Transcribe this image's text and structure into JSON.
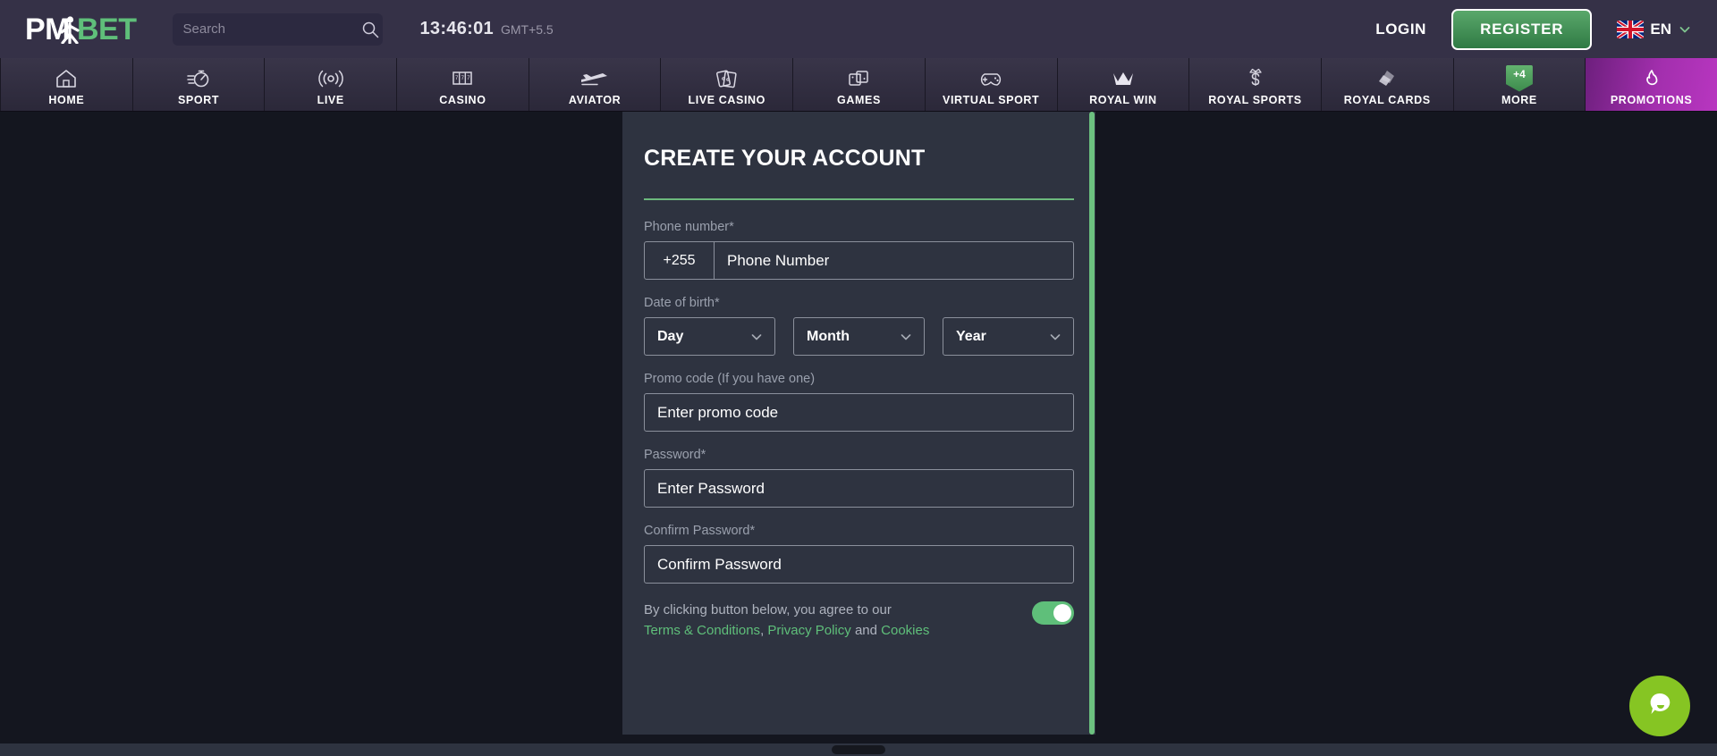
{
  "brand": {
    "logo_pm": "PM",
    "logo_bet": "BET",
    "logo_icon": "person-running-icon"
  },
  "header": {
    "search": {
      "placeholder": "Search",
      "value": "",
      "icon": "search-icon"
    },
    "clock": {
      "time": "13:46:01",
      "timezone": "GMT+5.5"
    },
    "login_label": "LOGIN",
    "register_label": "REGISTER",
    "language": {
      "code": "EN",
      "flag": "uk-flag-icon",
      "chevron": "chevron-down-icon"
    }
  },
  "nav": {
    "items": [
      {
        "label": "HOME",
        "icon": "home-icon",
        "active": false
      },
      {
        "label": "SPORT",
        "icon": "stopwatch-icon",
        "active": false
      },
      {
        "label": "LIVE",
        "icon": "broadcast-icon",
        "active": false
      },
      {
        "label": "CASINO",
        "icon": "slot-machine-icon",
        "active": false
      },
      {
        "label": "AVIATOR",
        "icon": "airplane-icon",
        "active": false
      },
      {
        "label": "LIVE CASINO",
        "icon": "playing-cards-icon",
        "active": false
      },
      {
        "label": "GAMES",
        "icon": "dice-icon",
        "active": false
      },
      {
        "label": "VIRTUAL SPORT",
        "icon": "gamepad-icon",
        "active": false
      },
      {
        "label": "ROYAL WIN",
        "icon": "crown-icon",
        "active": false
      },
      {
        "label": "ROYAL SPORTS",
        "icon": "crowned-s-icon",
        "active": false
      },
      {
        "label": "ROYAL CARDS",
        "icon": "stacked-cards-icon",
        "active": false
      },
      {
        "label": "MORE",
        "icon": "more-badge-icon",
        "badge": "+4",
        "active": false
      },
      {
        "label": "PROMOTIONS",
        "icon": "flame-icon",
        "active": true
      }
    ]
  },
  "registration": {
    "title": "CREATE YOUR ACCOUNT",
    "phone": {
      "label": "Phone number*",
      "prefix": "+255",
      "placeholder": "Phone Number",
      "value": ""
    },
    "dob": {
      "label": "Date of birth*",
      "day": {
        "value": "Day",
        "chevron": "chevron-down-icon"
      },
      "month": {
        "value": "Month",
        "chevron": "chevron-down-icon"
      },
      "year": {
        "value": "Year",
        "chevron": "chevron-down-icon"
      }
    },
    "promo": {
      "label": "Promo code (If you have one)",
      "placeholder": "Enter promo code",
      "value": ""
    },
    "password": {
      "label": "Password*",
      "placeholder": "Enter Password",
      "value": ""
    },
    "confirm_password": {
      "label": "Confirm Password*",
      "placeholder": "Confirm Password",
      "value": ""
    },
    "terms": {
      "line1": "By clicking button below, you agree to our",
      "link_terms": "Terms & Conditions",
      "separator": ",",
      "link_privacy": "Privacy Policy",
      "conjunction": "and",
      "link_cookies": "Cookies",
      "toggle_on": true
    }
  },
  "chat": {
    "icon": "chat-bubble-icon",
    "color": "#86c523"
  },
  "colors": {
    "header_bg": "#353147",
    "nav_bg": "#2f2c3e",
    "promo_accent": "#a32fae",
    "page_bg": "#14161f",
    "panel_bg": "#2e3340",
    "accent_green": "#5fbf7a"
  }
}
